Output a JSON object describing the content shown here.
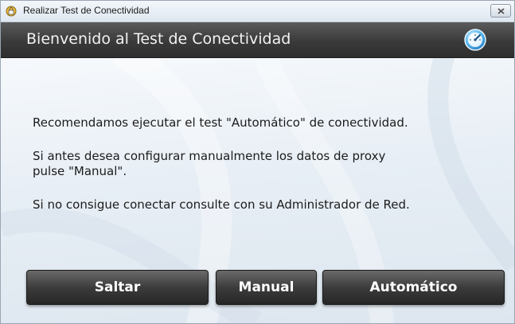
{
  "window": {
    "title": "Realizar Test de Conectividad"
  },
  "header": {
    "title": "Bienvenido al Test de Conectividad",
    "icon": "gauge-icon"
  },
  "messages": {
    "line1": "Recomendamos ejecutar el test \"Automático\" de conectividad.",
    "line2a": "Si antes desea configurar manualmente los datos de proxy",
    "line2b": "pulse \"Manual\".",
    "line3": "Si no consigue conectar consulte con su Administrador de Red."
  },
  "buttons": {
    "skip": "Saltar",
    "manual": "Manual",
    "auto": "Automático"
  },
  "colors": {
    "header_bg": "#3a3a3a",
    "button_bg": "#3c3c3c",
    "content_bg": "#e7eef5"
  }
}
